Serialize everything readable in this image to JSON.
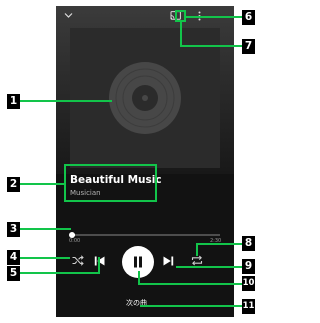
{
  "player": {
    "track_title": "Beautiful Music",
    "artist": "Musician",
    "elapsed": "0:00",
    "total": "2:30",
    "progress": 0.03,
    "next_song_label": "次の曲"
  },
  "icons": {
    "collapse": "chevron-down-icon",
    "cast": "cast-icon",
    "more": "more-vert-icon",
    "album_art": "vinyl-record-icon",
    "shuffle": "shuffle-icon",
    "previous": "skip-previous-icon",
    "play_pause": "pause-icon",
    "next": "skip-next-icon",
    "repeat": "repeat-icon"
  },
  "callouts": {
    "c1": "1",
    "c2": "2",
    "c3": "3",
    "c4": "4",
    "c5": "5",
    "c6": "6",
    "c7": "7",
    "c8": "8",
    "c9": "9",
    "c10": "10",
    "c11": "11"
  },
  "colors": {
    "highlight": "#12c44a",
    "callout_bg": "#000000",
    "screen_bg": "#121212"
  }
}
